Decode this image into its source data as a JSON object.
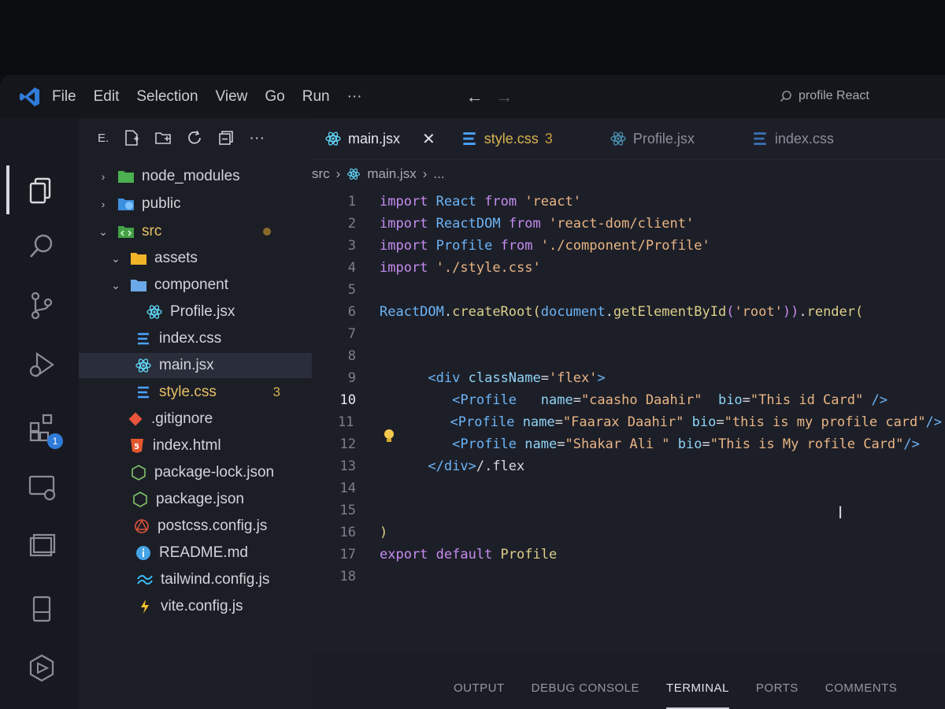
{
  "menu": [
    "File",
    "Edit",
    "Selection",
    "View",
    "Go",
    "Run",
    "···"
  ],
  "search": {
    "text": "profile React"
  },
  "sidebar": {
    "explorer_label": "E.",
    "items": [
      {
        "label": "node_modules",
        "kind": "folder",
        "icon": "folder-green-icon",
        "chevron": "›"
      },
      {
        "label": "public",
        "kind": "folder",
        "icon": "folder-globe-icon",
        "chevron": "›"
      },
      {
        "label": "src",
        "kind": "folder",
        "icon": "folder-src-icon",
        "chevron": "⌄"
      },
      {
        "label": "assets",
        "kind": "folder",
        "icon": "folder-yellow-icon",
        "chevron": "⌄"
      },
      {
        "label": "component",
        "kind": "folder",
        "icon": "folder-blue-icon",
        "chevron": "⌄"
      },
      {
        "label": "Profile.jsx",
        "kind": "file",
        "icon": "react-icon"
      },
      {
        "label": "index.css",
        "kind": "file",
        "icon": "css-icon"
      },
      {
        "label": "main.jsx",
        "kind": "file",
        "icon": "react-icon"
      },
      {
        "label": "style.css",
        "kind": "file",
        "icon": "css-icon",
        "badge": "3"
      },
      {
        "label": ".gitignore",
        "kind": "file",
        "icon": "git-icon"
      },
      {
        "label": "index.html",
        "kind": "file",
        "icon": "html-icon"
      },
      {
        "label": "package-lock.json",
        "kind": "file",
        "icon": "nodejs-icon"
      },
      {
        "label": "package.json",
        "kind": "file",
        "icon": "nodejs-icon"
      },
      {
        "label": "postcss.config.js",
        "kind": "file",
        "icon": "postcss-icon"
      },
      {
        "label": "README.md",
        "kind": "file",
        "icon": "info-icon"
      },
      {
        "label": "tailwind.config.js",
        "kind": "file",
        "icon": "tailwind-icon"
      },
      {
        "label": "vite.config.js",
        "kind": "file",
        "icon": "vite-icon"
      }
    ]
  },
  "activity": {
    "extensions_badge": "1"
  },
  "tabs": [
    {
      "label": "main.jsx",
      "active": true,
      "close": "✕"
    },
    {
      "label": "style.css",
      "count": "3"
    },
    {
      "label": "Profile.jsx"
    },
    {
      "label": "index.css"
    }
  ],
  "breadcrumb": {
    "folder": "src",
    "file": "main.jsx",
    "more": "..."
  },
  "code_lines": [
    "1",
    "2",
    "3",
    "4",
    "5",
    "6",
    "7",
    "8",
    "9",
    "10",
    "11",
    "12",
    "13",
    "14",
    "15",
    "16",
    "17",
    "18"
  ],
  "code": {
    "l1": {
      "k": "import",
      "i": "React",
      "f": "from",
      "s": "'react'"
    },
    "l2": {
      "k": "import",
      "i": "ReactDOM",
      "f": "from",
      "s": "'react-dom/client'"
    },
    "l3": {
      "k": "import",
      "i": "Profile",
      "f": "from",
      "s": "'./component/Profile'"
    },
    "l4": {
      "k": "import",
      "s": "'./style.css'"
    },
    "l6": {
      "a": "ReactDOM",
      "b": ".",
      "c": "createRoot",
      "d": "(",
      "e": "document",
      "g": ".",
      "h": "getElementById",
      "j": "(",
      "s": "'root'",
      "m": "))",
      "n": ".",
      "o": "render",
      "p": "("
    },
    "l9": {
      "open": "<div",
      "attr": "className",
      "eq": "=",
      "val": "'flex'",
      "close": ">"
    },
    "l10": {
      "tag": "<Profile",
      "a1": "name",
      "v1": "\"caasho Daahir\"",
      "a2": "bio",
      "v2": "\"This id Card\"",
      "end": "/>"
    },
    "l11": {
      "tag": "<Profile",
      "a1": "name",
      "v1": "\"Faarax Daahir\"",
      "a2": "bio",
      "v2": "\"this is my profile card\"",
      "end": "/>"
    },
    "l12": {
      "tag": "<Profile",
      "a1": "name",
      "v1": "\"Shakar Ali \"",
      "a2": "bio",
      "v2": "\"This is My rofile Card\"",
      "end": "/>"
    },
    "l13": {
      "tag": "</div>",
      "rest": "/.flex"
    },
    "l16": {
      "t": ")"
    },
    "l17": {
      "k": "export default",
      "i": "Profile"
    }
  },
  "panel_tabs": [
    "OUTPUT",
    "DEBUG CONSOLE",
    "TERMINAL",
    "PORTS",
    "COMMENTS"
  ],
  "colors": {
    "keyword": "#c58cf0",
    "identifier": "#6cb4f7",
    "string": "#e8b483",
    "accent": "#2f7bd8"
  }
}
